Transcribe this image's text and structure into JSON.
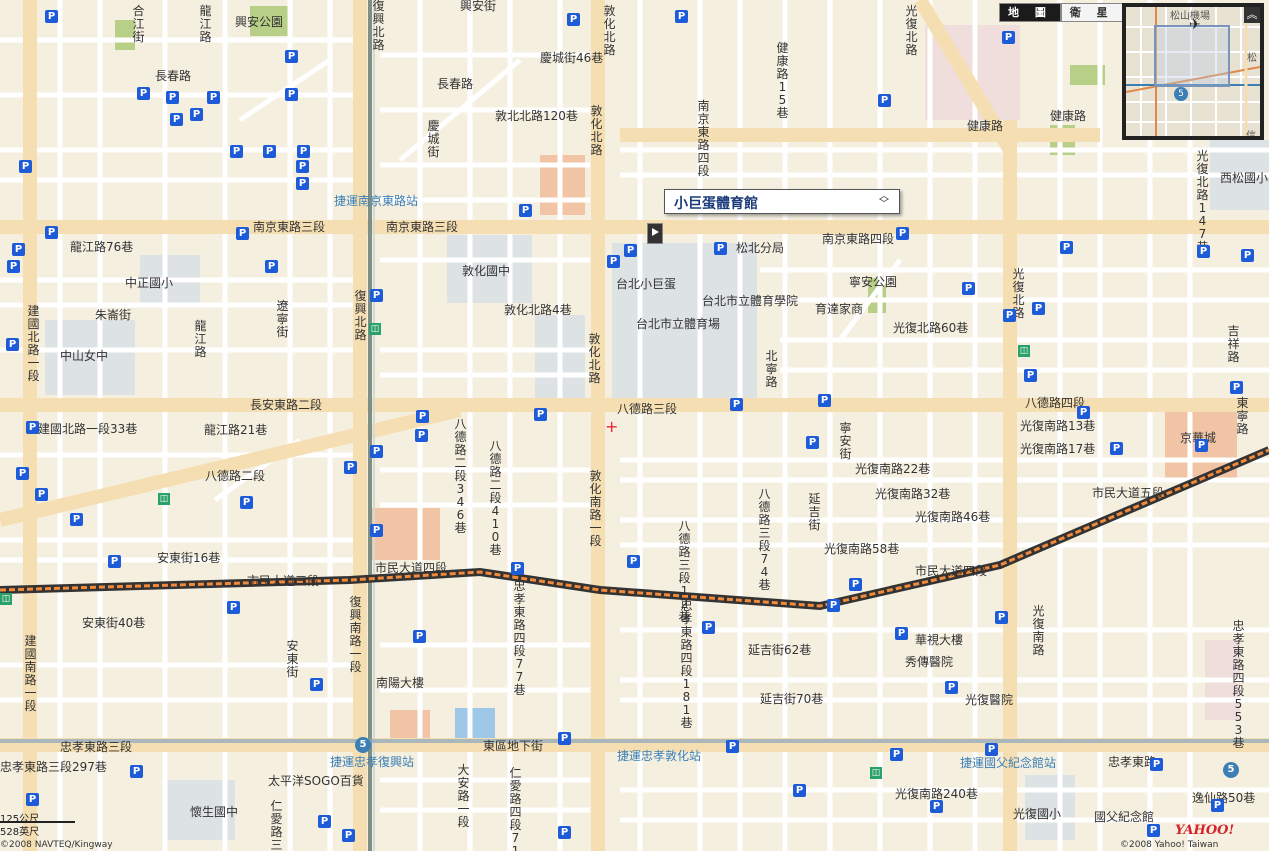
{
  "map_controls": {
    "map_label": "地 圖",
    "satellite_label": "衛 星",
    "overview_toggle": "︽",
    "overview_airport_label": "松山機場",
    "overview_right_label": "松",
    "overview_bottom_label": "信",
    "overview_mrt_badge": "5"
  },
  "callout": {
    "title": "小巨蛋體育館",
    "toggle": "︿\n﹀"
  },
  "attribution": {
    "scale_metric": "125公尺",
    "scale_imperial": "528英尺",
    "copyright_left": "©2008 NAVTEQ/Kingway",
    "copyright_right": "©2008 Yahoo! Taiwan",
    "brand": "YAHOO!"
  },
  "colors": {
    "background": "#f5efe0",
    "major_road": "#f5dfb2",
    "minor_road": "#ffffff",
    "block_green": "#d4e0bd",
    "block_salmon": "#f1c4a6",
    "block_gray": "#dde3e4",
    "park_green": "#b7cf86",
    "mrt_line": "#8aa6bf",
    "railway_orange": "#f28a3c",
    "parking_blue": "#1e5bd8",
    "callout_title": "#1a3a7a",
    "brand_red": "#d4242a"
  },
  "labels": [
    {
      "text": "合江街",
      "v": true
    },
    {
      "text": "龍江路",
      "v": true
    },
    {
      "text": "興安公園",
      "v": false
    },
    {
      "text": "復興北路",
      "v": true
    },
    {
      "text": "興安街",
      "v": false
    },
    {
      "text": "敦化北路",
      "v": true
    },
    {
      "text": "光復北路",
      "v": true
    },
    {
      "text": "長春路",
      "v": false
    },
    {
      "text": "慶城街46巷",
      "v": false
    },
    {
      "text": "長春路",
      "v": false
    },
    {
      "text": "健康路15巷",
      "v": true
    },
    {
      "text": "敦北北路120巷",
      "v": false
    },
    {
      "text": "慶城街",
      "v": true
    },
    {
      "text": "敦化北路",
      "v": true
    },
    {
      "text": "南京東路四段",
      "v": true
    },
    {
      "text": "健康路",
      "v": false
    },
    {
      "text": "健康路",
      "v": false
    },
    {
      "text": "西松國小",
      "v": false
    },
    {
      "text": "光復北路147巷",
      "v": true
    },
    {
      "text": "捷運南京東路站",
      "v": false
    },
    {
      "text": "南京東路三段",
      "v": false
    },
    {
      "text": "南京東路三段",
      "v": false
    },
    {
      "text": "松北分局",
      "v": false
    },
    {
      "text": "南京東路四段",
      "v": false
    },
    {
      "text": "龍江路76巷",
      "v": false
    },
    {
      "text": "敦化國中",
      "v": false
    },
    {
      "text": "中正國小",
      "v": false
    },
    {
      "text": "台北小巨蛋",
      "v": false
    },
    {
      "text": "寧安公園",
      "v": false
    },
    {
      "text": "光復北路",
      "v": true
    },
    {
      "text": "遼寧街",
      "v": true
    },
    {
      "text": "敦化北路4巷",
      "v": false
    },
    {
      "text": "台北市立體育學院",
      "v": false
    },
    {
      "text": "育達家商",
      "v": false
    },
    {
      "text": "朱崙街",
      "v": false
    },
    {
      "text": "建國北路一段",
      "v": true
    },
    {
      "text": "復興北路",
      "v": true
    },
    {
      "text": "台北市立體育場",
      "v": false
    },
    {
      "text": "光復北路60巷",
      "v": false
    },
    {
      "text": "吉祥路",
      "v": true
    },
    {
      "text": "龍江路",
      "v": true
    },
    {
      "text": "中山女中",
      "v": false
    },
    {
      "text": "北寧路",
      "v": true
    },
    {
      "text": "敦化北路",
      "v": true
    },
    {
      "text": "長安東路二段",
      "v": false
    },
    {
      "text": "八德路三段",
      "v": false
    },
    {
      "text": "八德路四段",
      "v": false
    },
    {
      "text": "東寧路",
      "v": true
    },
    {
      "text": "建國北路一段33巷",
      "v": false
    },
    {
      "text": "龍江路21巷",
      "v": false
    },
    {
      "text": "八德路二段346巷",
      "v": true
    },
    {
      "text": "八德路二段410巷",
      "v": true
    },
    {
      "text": "寧安街",
      "v": true
    },
    {
      "text": "光復南路13巷",
      "v": false
    },
    {
      "text": "光復南路17巷",
      "v": false
    },
    {
      "text": "京華城",
      "v": false
    },
    {
      "text": "八德路二段",
      "v": false
    },
    {
      "text": "敦化南路一段",
      "v": true
    },
    {
      "text": "八德路三段12巷",
      "v": true
    },
    {
      "text": "八德路三段74巷",
      "v": true
    },
    {
      "text": "延吉街",
      "v": true
    },
    {
      "text": "光復南路22巷",
      "v": false
    },
    {
      "text": "光復南路32巷",
      "v": false
    },
    {
      "text": "光復南路46巷",
      "v": false
    },
    {
      "text": "市民大道五段",
      "v": false
    },
    {
      "text": "安東街16巷",
      "v": false
    },
    {
      "text": "光復南路58巷",
      "v": false
    },
    {
      "text": "市民大道三段",
      "v": false
    },
    {
      "text": "市民大道四段",
      "v": false
    },
    {
      "text": "市民大道四段",
      "v": false
    },
    {
      "text": "復興南路一段",
      "v": true
    },
    {
      "text": "忠孝東路四段77巷",
      "v": true
    },
    {
      "text": "忠孝東路四段181巷",
      "v": true
    },
    {
      "text": "安東街40巷",
      "v": false
    },
    {
      "text": "延吉街62巷",
      "v": false
    },
    {
      "text": "華視大樓",
      "v": false
    },
    {
      "text": "光復南路",
      "v": true
    },
    {
      "text": "忠孝東路四段553巷",
      "v": true
    },
    {
      "text": "建國南路一段",
      "v": true
    },
    {
      "text": "安東街",
      "v": true
    },
    {
      "text": "秀傳醫院",
      "v": false
    },
    {
      "text": "南陽大樓",
      "v": false
    },
    {
      "text": "延吉街70巷",
      "v": false
    },
    {
      "text": "光復醫院",
      "v": false
    },
    {
      "text": "忠孝東路三段",
      "v": false
    },
    {
      "text": "東區地下街",
      "v": false
    },
    {
      "text": "捷運忠孝復興站",
      "v": false
    },
    {
      "text": "捷運忠孝敦化站",
      "v": false
    },
    {
      "text": "捷運國父紀念館站",
      "v": false
    },
    {
      "text": "忠孝東路",
      "v": false
    },
    {
      "text": "忠孝東路三段297巷",
      "v": false
    },
    {
      "text": "太平洋SOGO百貨",
      "v": false
    },
    {
      "text": "大安路一段",
      "v": true
    },
    {
      "text": "仁愛路四段71巷",
      "v": true
    },
    {
      "text": "光復南路240巷",
      "v": false
    },
    {
      "text": "逸仙路50巷",
      "v": false
    },
    {
      "text": "懷生國中",
      "v": false
    },
    {
      "text": "仁愛路三段",
      "v": true
    },
    {
      "text": "光復國小",
      "v": false
    },
    {
      "text": "國父紀念館",
      "v": false
    }
  ]
}
